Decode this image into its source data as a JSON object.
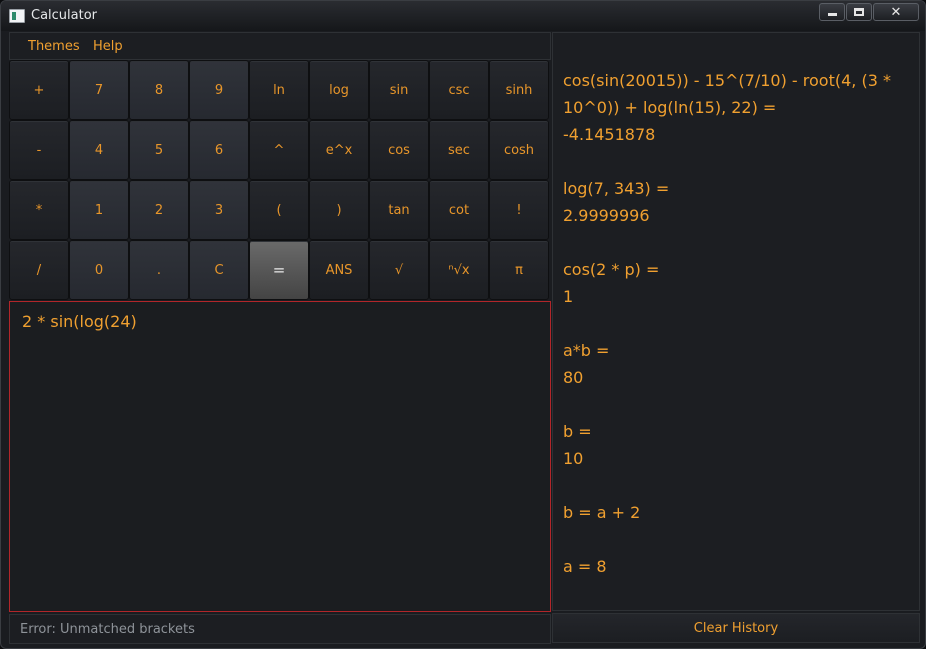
{
  "window": {
    "title": "Calculator"
  },
  "menu": {
    "themes": "Themes",
    "help": "Help"
  },
  "keys": [
    "+",
    "7",
    "8",
    "9",
    "ln",
    "log",
    "sin",
    "csc",
    "sinh",
    "-",
    "4",
    "5",
    "6",
    "^",
    "e^x",
    "cos",
    "sec",
    "cosh",
    "*",
    "1",
    "2",
    "3",
    "(",
    ")",
    "tan",
    "cot",
    "!",
    "/",
    "0",
    ".",
    "C",
    "=",
    "ANS",
    "√",
    "ⁿ√x",
    "π"
  ],
  "editor": {
    "expression": "2 * sin(log(24)"
  },
  "status": {
    "message": "Error: Unmatched brackets"
  },
  "history": [
    {
      "expression": "cos(sin(20015)) - 15^(7/10) - root(4, (3 * 10^0)) + log(ln(15), 22) =",
      "result": "-4.1451878"
    },
    {
      "expression": "log(7, 343) =",
      "result": "2.9999996"
    },
    {
      "expression": "cos(2 * p) =",
      "result": "1"
    },
    {
      "expression": "a*b =",
      "result": "80"
    },
    {
      "expression": "b =",
      "result": "10"
    },
    {
      "expression": "b = a + 2",
      "result": ""
    },
    {
      "expression": "a = 8",
      "result": ""
    }
  ],
  "clear_history": "Clear History",
  "colors": {
    "accent": "#f0a030",
    "error_border": "#b2262a",
    "status_text": "#8e9399"
  }
}
